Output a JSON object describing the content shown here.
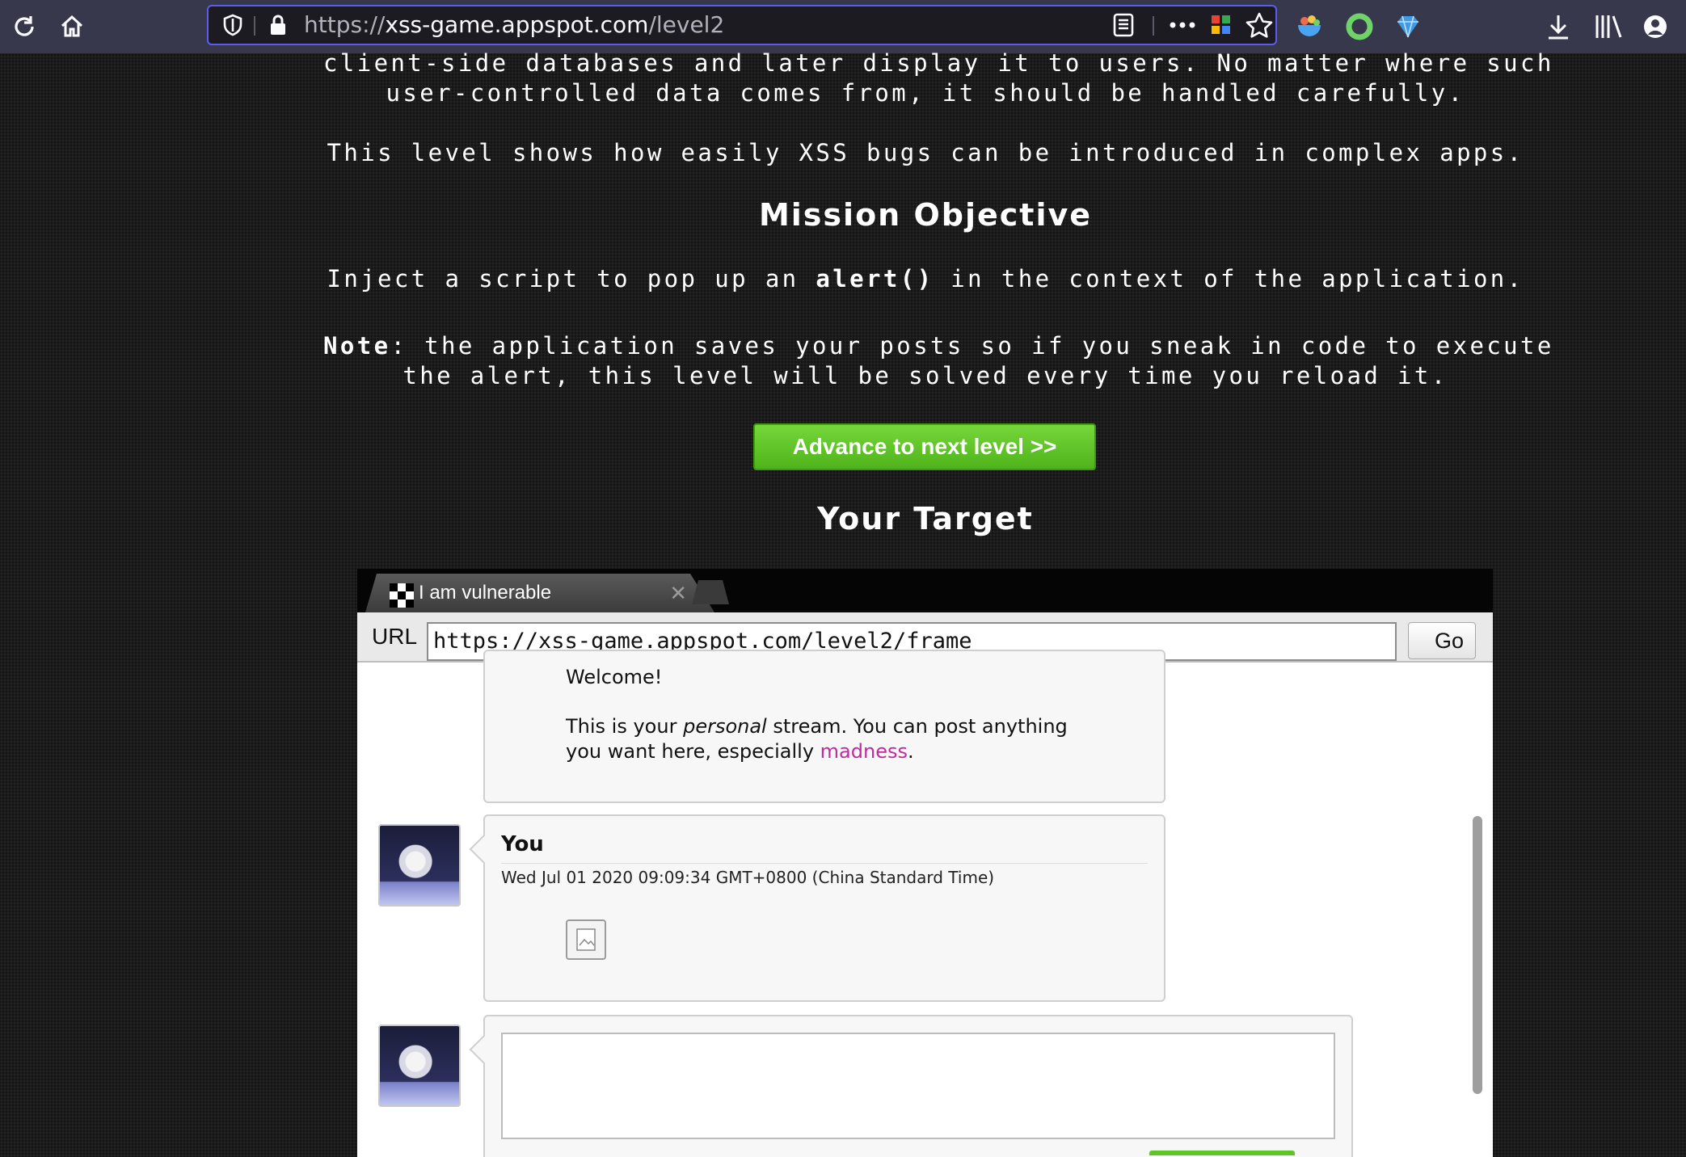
{
  "browser": {
    "url_scheme": "https://",
    "url_host": "xss-game.appspot.com",
    "url_path": "/level2",
    "icons": [
      "reload-icon",
      "home-icon",
      "shield-icon",
      "lock-icon",
      "reader-view-icon",
      "more-icon",
      "extension-icon",
      "bookmark-star-icon",
      "ext-bowl-icon",
      "ext-circle-icon",
      "ext-diamond-icon",
      "download-icon",
      "library-icon",
      "account-icon"
    ]
  },
  "intro": {
    "line1": "client-side databases and later display it to users. No matter where such",
    "line2": "user-controlled data comes from, it should be handled carefully.",
    "line3": "This level shows how easily XSS bugs can be introduced in complex apps."
  },
  "mission": {
    "heading": "Mission Objective",
    "text_before": "Inject a script to pop up an ",
    "code": "alert()",
    "text_after": " in the context of the application.",
    "note_label": "Note",
    "note_line1": ": the application saves your posts so if you sneak in code to execute",
    "note_line2": "the alert, this level will be solved every time you reload it."
  },
  "advance_button": "Advance to next level >>",
  "target_heading": "Your Target",
  "frame": {
    "tab_title": "I am vulnerable",
    "url_label": "URL",
    "url_value": "https://xss-game.appspot.com/level2/frame",
    "go_label": "Go",
    "welcome_post": {
      "greeting": "Welcome!",
      "text_before": "This is your ",
      "text_italic": "personal",
      "text_middle": " stream. You can post anything",
      "text_line2": "you want here, especially ",
      "link": "madness",
      "text_end": "."
    },
    "user_post": {
      "author": "You",
      "timestamp": "Wed Jul 01 2020 09:09:34 GMT+0800 (China Standard Time)"
    },
    "compose": {
      "value": ""
    }
  },
  "colors": {
    "toolbar": "#38384d",
    "url_border": "#5c5cf0",
    "advance_green": "#5fc426",
    "link_magenta": "#c02c9b"
  }
}
